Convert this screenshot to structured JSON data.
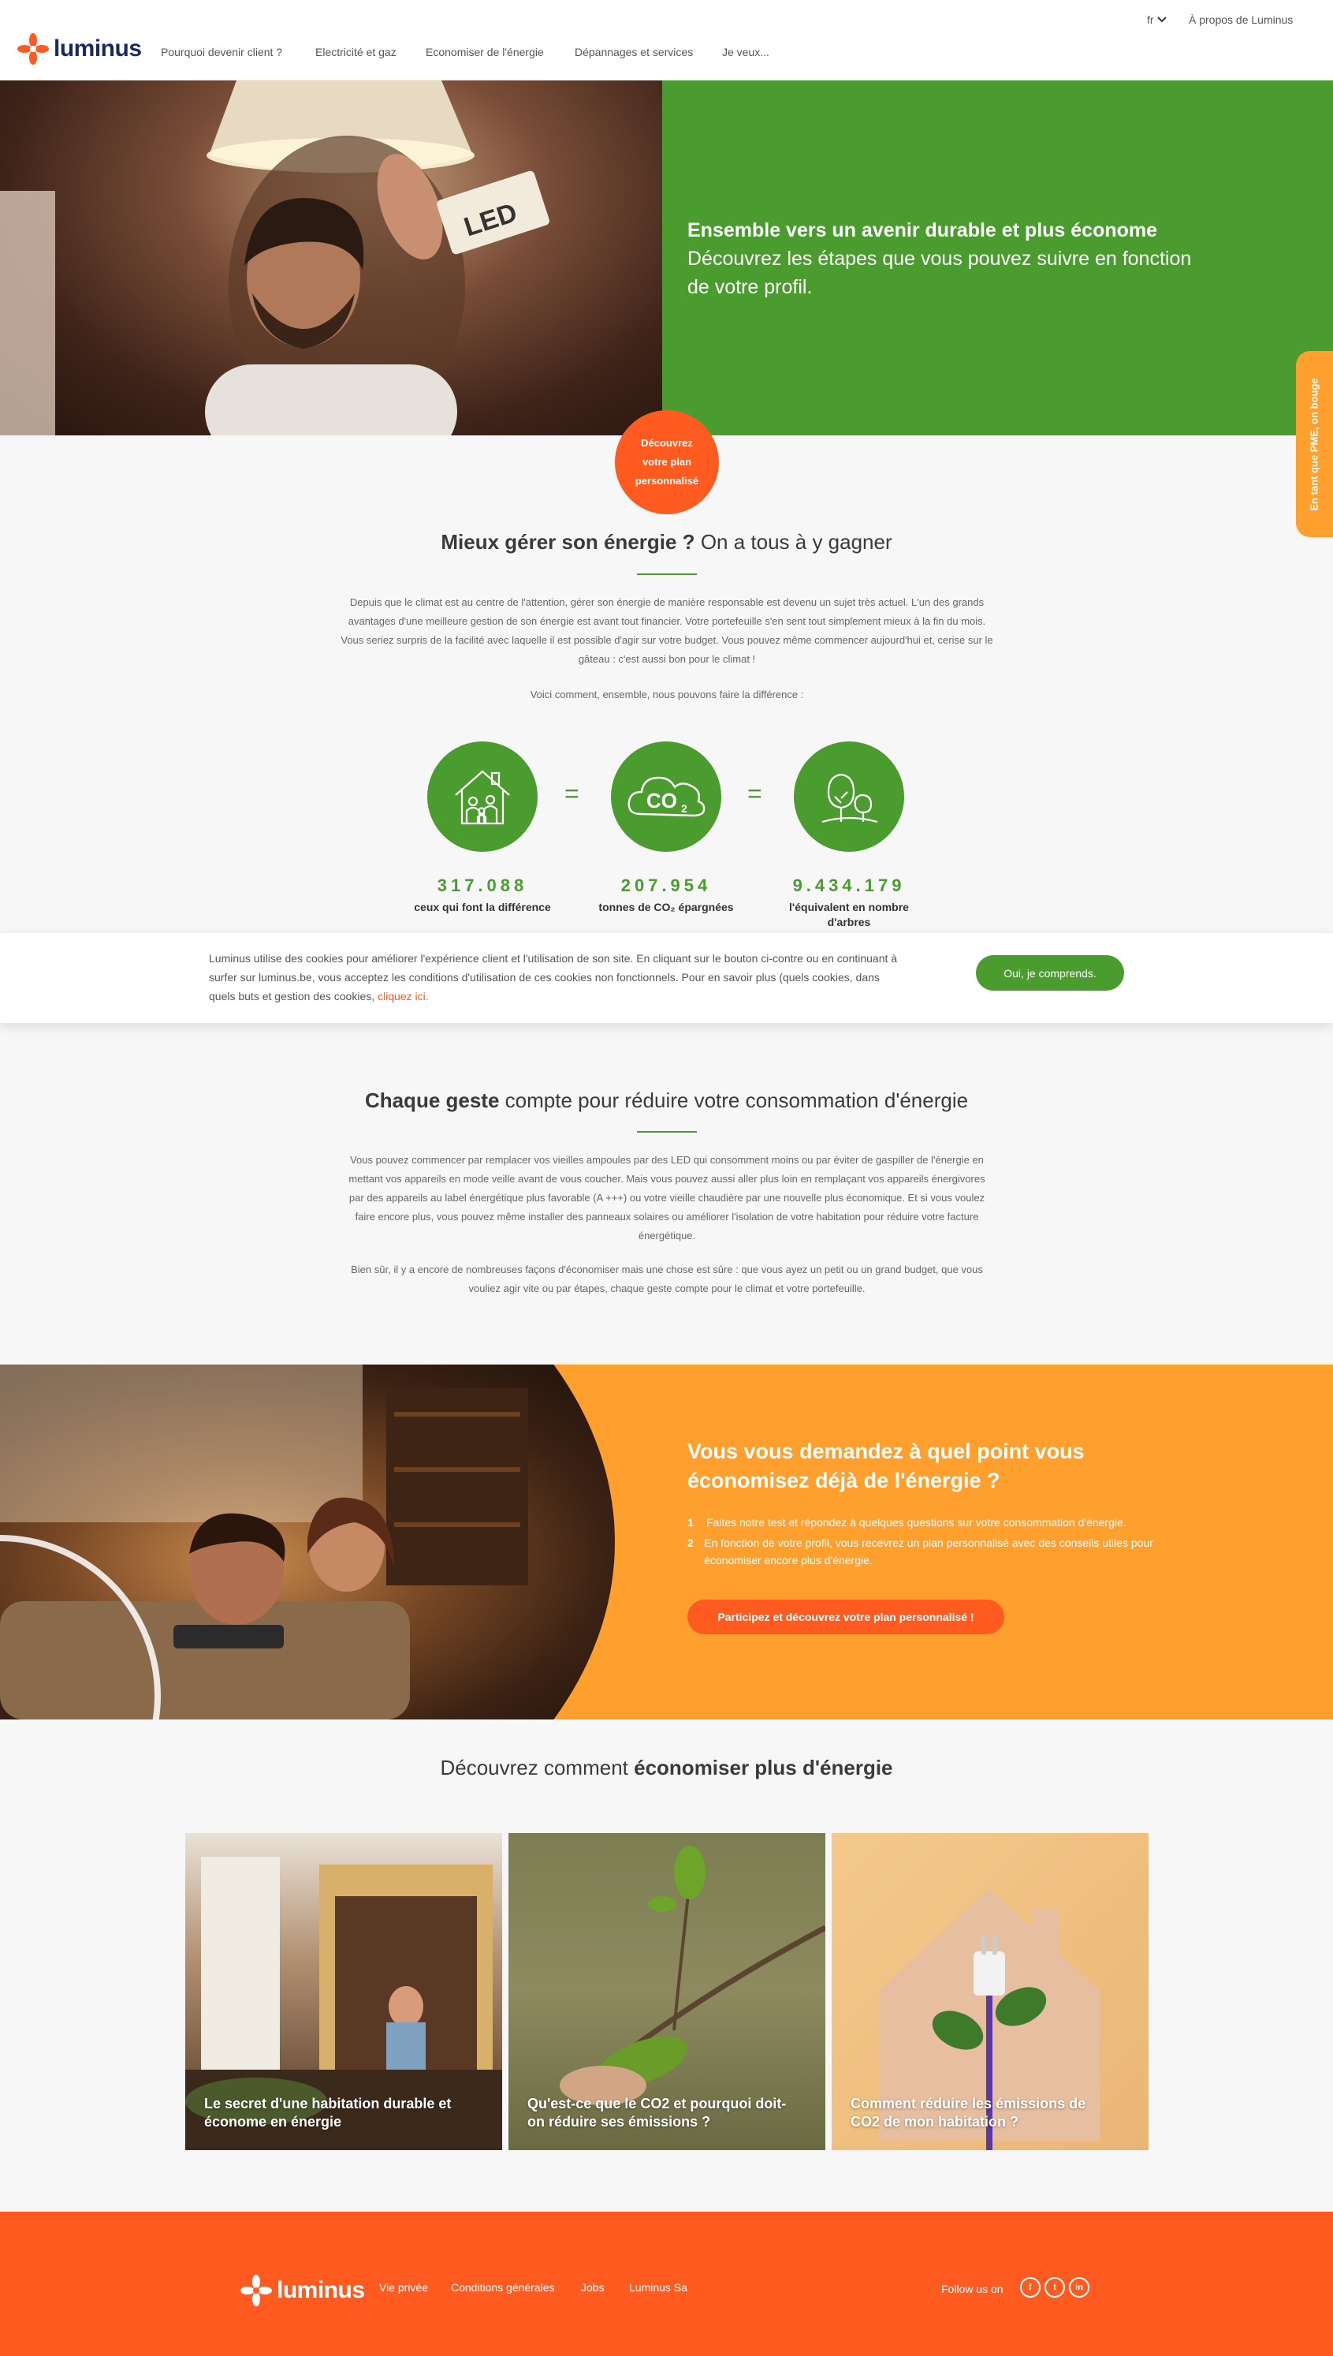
{
  "header": {
    "brand": "luminus",
    "lang": "fr",
    "about": "À propos de Luminus",
    "nav": [
      "Pourquoi devenir client ?",
      "Electricité et gaz",
      "Economiser de l'énergie",
      "Dépannages et services",
      "Je veux..."
    ]
  },
  "hero": {
    "title": "Ensemble vers un avenir durable et plus économe",
    "subtitle": "Découvrez les étapes que vous pouvez suivre en fonction de votre profil.",
    "cta": "Découvrez votre plan personnalisé",
    "bulb_text": "LED"
  },
  "side_tab": "En tant que PME, on bouge",
  "section1": {
    "title_bold": "Mieux gérer son énergie ?",
    "title_light": "On a tous à y gagner",
    "body": "Depuis que le climat est au centre de l'attention, gérer son énergie de manière responsable est devenu un sujet très actuel. L'un des grands avantages d'une meilleure gestion de son énergie est avant tout financier. Votre portefeuille s'en sent tout simplement mieux à la fin du mois. Vous seriez surpris de la facilité avec laquelle il est possible d'agir sur votre budget. Vous pouvez même commencer aujourd'hui et, cerise sur le gâteau : c'est aussi bon pour le climat !",
    "intro": "Voici comment, ensemble, nous pouvons faire la différence :",
    "stats": [
      {
        "value": "317.088",
        "label": "ceux qui font la différence",
        "icon": "house-family-icon"
      },
      {
        "value": "207.954",
        "label": "tonnes de CO₂ épargnées",
        "icon": "co2-cloud-icon"
      },
      {
        "value": "9.434.179",
        "label": "l'équivalent en nombre d'arbres",
        "icon": "trees-icon"
      }
    ],
    "co2_text": "CO",
    "co2_sub": "2",
    "eq": "="
  },
  "cookie": {
    "text": "Luminus utilise des cookies pour améliorer l'expérience client et l'utilisation de son site. En cliquant sur le bouton ci-contre ou en continuant à surfer sur luminus.be, vous acceptez les conditions d'utilisation de ces cookies non fonctionnels. Pour en savoir plus (quels cookies, dans quels buts et gestion des cookies,",
    "link": "cliquez ici.",
    "button": "Oui, je comprends."
  },
  "section2": {
    "title_bold": "Chaque geste",
    "title_light": "compte pour réduire votre consommation d'énergie",
    "p1": "Vous pouvez commencer par remplacer vos vieilles ampoules par des LED qui consomment moins ou par éviter de gaspiller de l'énergie en mettant vos appareils en mode veille avant de vous coucher. Mais vous pouvez aussi aller plus loin en remplaçant vos appareils énergivores par des appareils au label énergétique plus favorable (A +++) ou votre vieille chaudière par une nouvelle plus économique. Et si vous voulez faire encore plus, vous pouvez même installer des panneaux solaires ou améliorer l'isolation de votre habitation pour réduire votre facture énergétique.",
    "p2": "Bien sûr, il y a encore de nombreuses façons d'économiser mais une chose est sûre : que vous ayez un petit ou un grand budget, que vous vouliez agir vite ou par étapes, chaque geste compte pour le climat et votre portefeuille."
  },
  "quiz": {
    "title": "Vous vous demandez à quel point vous économisez déjà de l'énergie ?",
    "steps": [
      {
        "n": "1",
        "text": "Faites notre test et répondez à quelques questions sur votre consommation d'énergie."
      },
      {
        "n": "2",
        "text": "En fonction de votre profil, vous recevrez un plan personnalisé avec des conseils utiles pour économiser encore plus d'énergie."
      }
    ],
    "button": "Participez et découvrez votre plan personnalisé !"
  },
  "discover": {
    "title_light": "Découvrez comment",
    "title_bold": "économiser plus d'énergie",
    "cards": [
      {
        "title": "Le secret d'une habitation durable et économe en énergie"
      },
      {
        "title": "Qu'est-ce que le CO2 et pourquoi doit-on réduire ses émissions ?"
      },
      {
        "title": "Comment réduire les émissions de CO2 de mon habitation ?"
      }
    ]
  },
  "footer": {
    "brand": "luminus",
    "links": [
      "Vie privée",
      "Conditions générales",
      "Jobs",
      "Luminus Sa"
    ],
    "follow": "Follow us on",
    "social": [
      "f",
      "t",
      "in"
    ]
  },
  "colors": {
    "green": "#4b9c2e",
    "orange": "#ff9f2e",
    "red_orange": "#ff5a1f",
    "navy": "#1a2a5e"
  }
}
